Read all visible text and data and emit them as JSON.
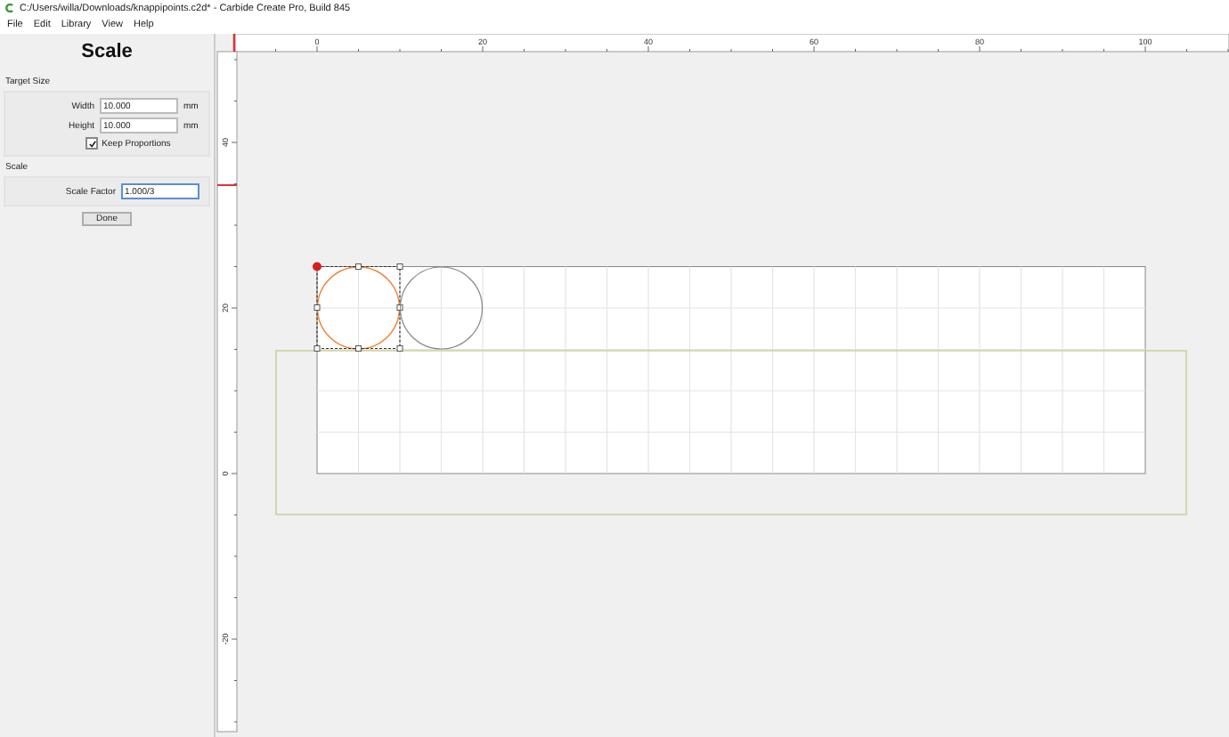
{
  "window": {
    "title": "C:/Users/willa/Downloads/knappipoints.c2d* - Carbide Create Pro, Build 845"
  },
  "menu": [
    {
      "label": "File"
    },
    {
      "label": "Edit"
    },
    {
      "label": "Library"
    },
    {
      "label": "View"
    },
    {
      "label": "Help"
    }
  ],
  "panel": {
    "title": "Scale",
    "target_size": {
      "heading": "Target Size",
      "width": {
        "label": "Width",
        "value": "10.000",
        "unit": "mm"
      },
      "height": {
        "label": "Height",
        "value": "10.000",
        "unit": "mm"
      },
      "keep_proportions": {
        "label": "Keep Proportions",
        "checked": true
      }
    },
    "scale": {
      "heading": "Scale",
      "factor": {
        "label": "Scale Factor",
        "value": "1.000/3",
        "focused": true
      }
    },
    "done_button": "Done"
  },
  "rulers": {
    "top_labels": [
      "0",
      "20",
      "40",
      "60",
      "80",
      "100"
    ],
    "left_labels": [
      "40",
      "20",
      "0",
      "-20"
    ]
  }
}
